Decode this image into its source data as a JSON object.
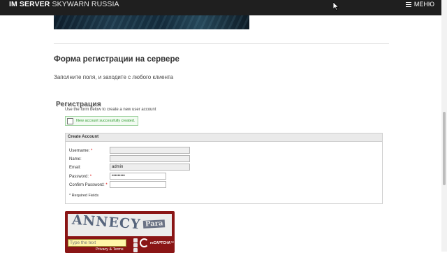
{
  "header": {
    "brand_bold": "IM SERVER",
    "brand_light": "SKYWARN RUSSIA",
    "menu_label": "МЕНЮ",
    "menu_icon": "hamburger-icon"
  },
  "content": {
    "section_title": "Форма регистрации на сервере",
    "intro": "Заполните поля, и заходите с любого клиента"
  },
  "registration": {
    "title": "Регистрация",
    "subtitle": "Use the form below to create a new user account",
    "success_message": "New account successfully created.",
    "panel_title": "Create Account",
    "fields": [
      {
        "label": "Username:",
        "required": true,
        "value": ""
      },
      {
        "label": "Name:",
        "required": false,
        "value": ""
      },
      {
        "label": "Email:",
        "required": false,
        "value": "admin"
      },
      {
        "label": "Password:",
        "required": true,
        "value": "•••••••••"
      },
      {
        "label": "Confirm Password:",
        "required": true,
        "value": ""
      }
    ],
    "required_note": "* Required Fields"
  },
  "captcha": {
    "word1": "ANNECY",
    "word2": "Para",
    "placeholder": "Type the text",
    "privacy": "Privacy & Terms",
    "logo_text": "reCAPTCHA™"
  }
}
